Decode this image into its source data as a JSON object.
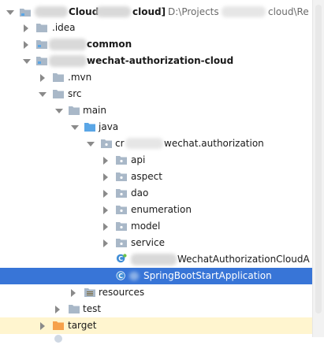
{
  "tree": {
    "root": {
      "name": "Cloud",
      "name_suffix": "cloud]",
      "path_prefix": "D:\\Projects",
      "path_suffix": "cloud\\Re"
    },
    "idea": ".idea",
    "common": "common",
    "auth_module": "wechat-authorization-cloud",
    "mvn": ".mvn",
    "src": "src",
    "main": "main",
    "java": "java",
    "package_prefix": "cr",
    "package_suffix": "wechat.authorization",
    "packages": [
      "api",
      "aspect",
      "dao",
      "enumeration",
      "model",
      "service"
    ],
    "cloud_app_class": "WechatAuthorizationCloudA",
    "spring_boot_class": "SpringBootStartApplication",
    "resources": "resources",
    "test": "test",
    "target": "target"
  },
  "colors": {
    "selection": "#3875d7",
    "folder": "#a9b8c8",
    "source_folder": "#5aa6e6",
    "target_folder": "#f6a14a",
    "class_icon": "#3f8dd6"
  }
}
